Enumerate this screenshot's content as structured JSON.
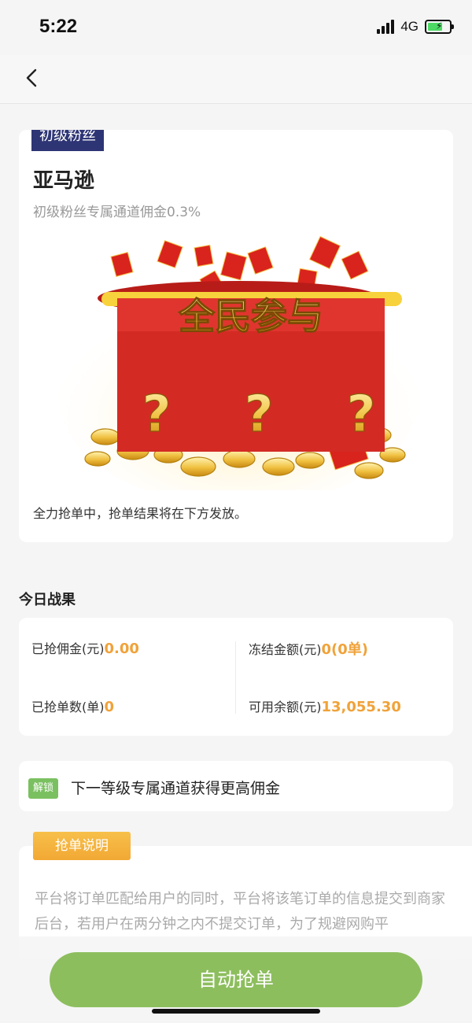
{
  "status_bar": {
    "time": "5:22",
    "network": "4G"
  },
  "nav": {
    "back_icon": "chevron-left-icon"
  },
  "hero": {
    "level_tag": "初级粉丝",
    "platform_name": "亚马逊",
    "rate_text": "初级粉丝专属通道佣金0.3%",
    "illustration_banner": "全民参与",
    "illustration_marks": [
      "?",
      "?",
      "?"
    ],
    "status_message": "全力抢单中，抢单结果将在下方发放。"
  },
  "results": {
    "title": "今日战果",
    "grabbed_commission_label": "已抢佣金(元)",
    "grabbed_commission_value": "0.00",
    "frozen_amount_label": "冻结金额(元)",
    "frozen_amount_value": "0(0单)",
    "grabbed_orders_label": "已抢单数(单)",
    "grabbed_orders_value": "0",
    "available_balance_label": "可用余额(元)",
    "available_balance_value": "13,055.30"
  },
  "unlock": {
    "badge": "解锁",
    "text": "下一等级专属通道获得更高佣金"
  },
  "rules": {
    "tag": "抢单说明",
    "text": "平台将订单匹配给用户的同时，平台将该笔订单的信息提交到商家后台，若用户在两分钟之内不提交订单，为了规避网购平"
  },
  "action": {
    "auto_grab_label": "自动抢单"
  },
  "colors": {
    "accent_orange": "#f0a23a",
    "button_green": "#8dbe5e",
    "badge_green": "#7ac060",
    "level_tag_navy": "#2e3575",
    "envelope_red": "#d42a24"
  }
}
